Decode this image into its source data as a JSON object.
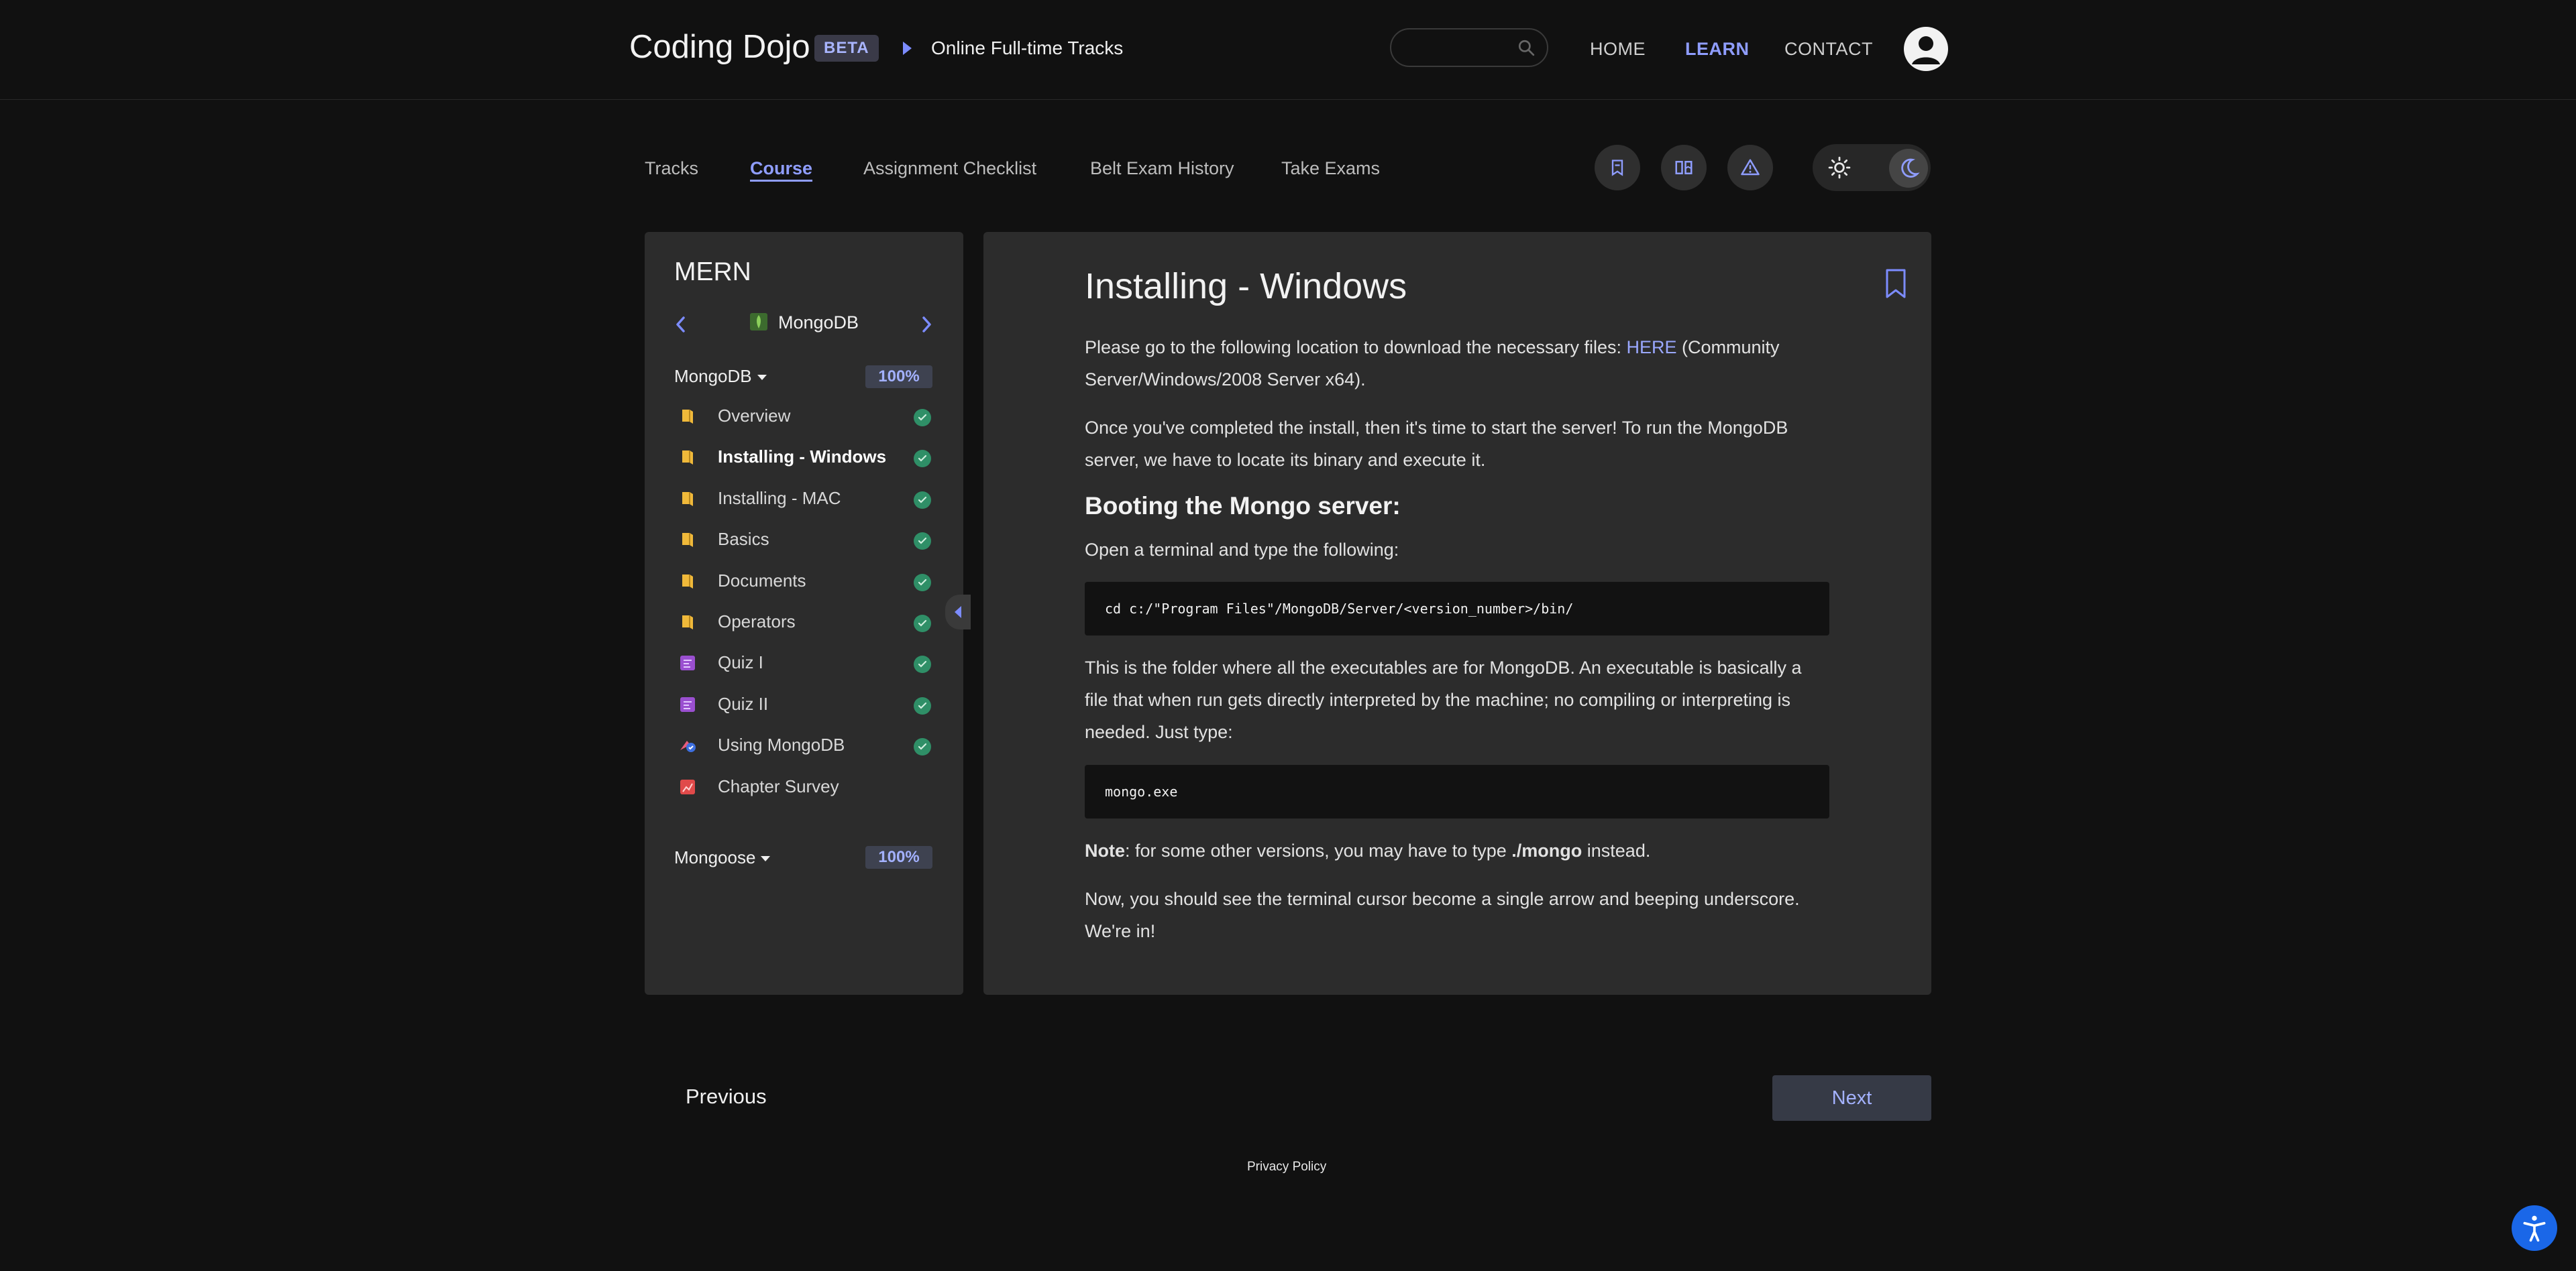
{
  "header": {
    "brand": "Coding Dojo",
    "beta": "BETA",
    "breadcrumb": "Online Full-time Tracks",
    "search": {
      "placeholder": ""
    },
    "nav": [
      {
        "label": "HOME",
        "active": false
      },
      {
        "label": "LEARN",
        "active": true
      },
      {
        "label": "CONTACT",
        "active": false
      }
    ]
  },
  "subnav": {
    "tabs": [
      "Tracks",
      "Course",
      "Assignment Checklist",
      "Belt Exam History",
      "Take Exams"
    ],
    "active_tab": "Course"
  },
  "sidebar": {
    "title": "MERN",
    "current_course": "MongoDB",
    "sections": [
      {
        "title": "MongoDB",
        "progress": "100%",
        "items": [
          {
            "label": "Overview",
            "icon": "book-icon",
            "done": true
          },
          {
            "label": "Installing - Windows",
            "icon": "book-icon",
            "done": true,
            "active": true
          },
          {
            "label": "Installing - MAC",
            "icon": "book-icon",
            "done": true
          },
          {
            "label": "Basics",
            "icon": "book-icon",
            "done": true
          },
          {
            "label": "Documents",
            "icon": "book-icon",
            "done": true
          },
          {
            "label": "Operators",
            "icon": "book-icon",
            "done": true
          },
          {
            "label": "Quiz I",
            "icon": "quiz-icon",
            "done": true
          },
          {
            "label": "Quiz II",
            "icon": "quiz-icon",
            "done": true
          },
          {
            "label": "Using MongoDB",
            "icon": "assignment-icon",
            "done": true
          },
          {
            "label": "Chapter Survey",
            "icon": "survey-icon",
            "done": false
          }
        ]
      },
      {
        "title": "Mongoose",
        "progress": "100%"
      }
    ]
  },
  "content": {
    "title": "Installing - Windows",
    "p1_before": "Please go to the following location to download the necessary files: ",
    "p1_link": "HERE",
    "p1_after": " (Community Server/Windows/2008 Server x64).",
    "p2": "Once you've completed the install, then it's time to start the server! To run the MongoDB server, we have to locate its binary and execute it.",
    "h2": "Booting the Mongo server:",
    "p3": "Open a terminal and type the following:",
    "code1": "cd c:/\"Program Files\"/MongoDB/Server/<version_number>/bin/",
    "p4": "This is the folder where all the executables are for MongoDB. An executable is basically a file that when run gets directly interpreted by the machine; no compiling or interpreting is needed. Just type:",
    "code2": "mongo.exe",
    "note_label": "Note",
    "note_before": ": for some other versions, you may have to type ",
    "note_cmd": "./mongo",
    "note_after": " instead.",
    "p5": "Now, you should see the terminal cursor become a single arrow and beeping underscore. We're in!"
  },
  "footer": {
    "previous": "Previous",
    "next": "Next",
    "privacy": "Privacy Policy"
  },
  "colors": {
    "accent": "#8f9dff",
    "check": "#2f8f67",
    "book": "#f0b93a",
    "quiz": "#9a4fd0",
    "survey": "#e04a4a"
  }
}
